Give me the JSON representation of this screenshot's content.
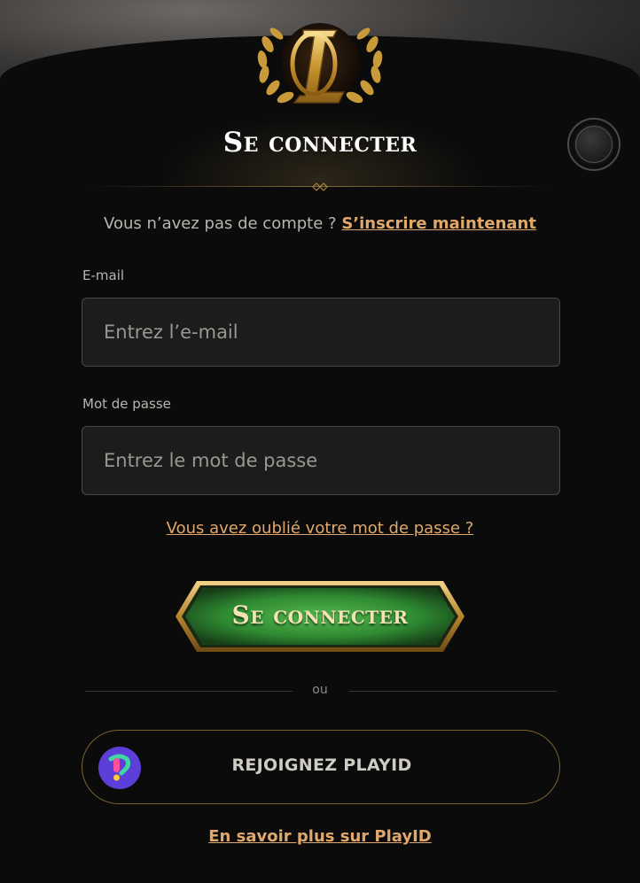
{
  "header": {
    "title": "Se connecter",
    "close_icon": "close-circle-icon"
  },
  "signup": {
    "prompt": "Vous n’avez pas de compte ? ",
    "link": "S’inscrire maintenant"
  },
  "form": {
    "email_label": "E-mail",
    "email_placeholder": "Entrez l’e-mail",
    "password_label": "Mot de passe",
    "password_placeholder": "Entrez le mot de passe",
    "forgot_link": "Vous avez oublié votre mot de passe ?",
    "submit_label": "Se connecter"
  },
  "separator": {
    "text": "ou"
  },
  "playid": {
    "button_label": "REJOIGNEZ PLAYID",
    "learn_more": "En savoir plus sur PlayID"
  },
  "colors": {
    "accent_gold": "#e0a96b",
    "panel_bg": "#0b0b0b",
    "submit_green": "#2f8a32",
    "playid_purple": "#5b3fd8"
  }
}
